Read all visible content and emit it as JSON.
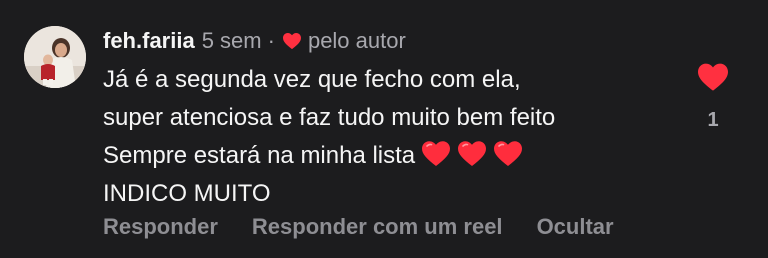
{
  "comment": {
    "username": "feh.fariia",
    "time": "5 sem",
    "separator": "·",
    "author_like_label": "pelo autor",
    "lines": [
      "Já é a segunda vez que fecho com ela,",
      "super atenciosa e faz tudo muito bem feito",
      "Sempre estará na minha lista",
      "INDICO MUITO"
    ],
    "emoji_icon": "red-heart-emoji",
    "like_count": "1",
    "liked": true
  },
  "actions": {
    "reply_label": "Responder",
    "reel_reply_label": "Responder com um reel",
    "hide_label": "Ocultar"
  },
  "colors": {
    "background": "#1c1c1e",
    "heart": "#ff3040",
    "text": "#f5f5f5",
    "secondary": "#a8a8ae",
    "action": "#8e8e93"
  }
}
